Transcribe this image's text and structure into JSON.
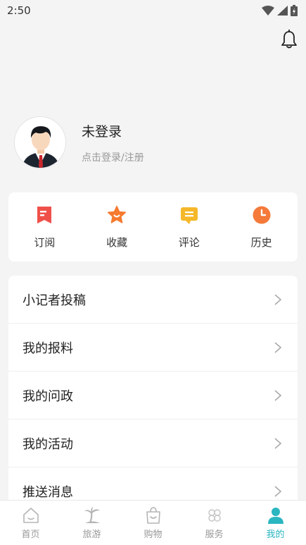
{
  "status_bar": {
    "time": "2:50"
  },
  "profile": {
    "name": "未登录",
    "hint": "点击登录/注册"
  },
  "quick_actions": [
    {
      "label": "订阅",
      "icon": "bookmark-icon",
      "color": "#f0504a"
    },
    {
      "label": "收藏",
      "icon": "star-icon",
      "color": "#f57a2f"
    },
    {
      "label": "评论",
      "icon": "comment-icon",
      "color": "#f5b82a"
    },
    {
      "label": "历史",
      "icon": "clock-icon",
      "color": "#f57a3a"
    }
  ],
  "menu": [
    {
      "label": "小记者投稿"
    },
    {
      "label": "我的报料"
    },
    {
      "label": "我的问政"
    },
    {
      "label": "我的活动"
    },
    {
      "label": "推送消息"
    }
  ],
  "tabbar": {
    "accent": "#29b6c1",
    "tabs": [
      {
        "label": "首页",
        "icon": "home-icon",
        "active": false
      },
      {
        "label": "旅游",
        "icon": "palm-tree-icon",
        "active": false
      },
      {
        "label": "购物",
        "icon": "shopping-bag-icon",
        "active": false
      },
      {
        "label": "服务",
        "icon": "service-icon",
        "active": false
      },
      {
        "label": "我的",
        "icon": "user-icon",
        "active": true
      }
    ]
  }
}
